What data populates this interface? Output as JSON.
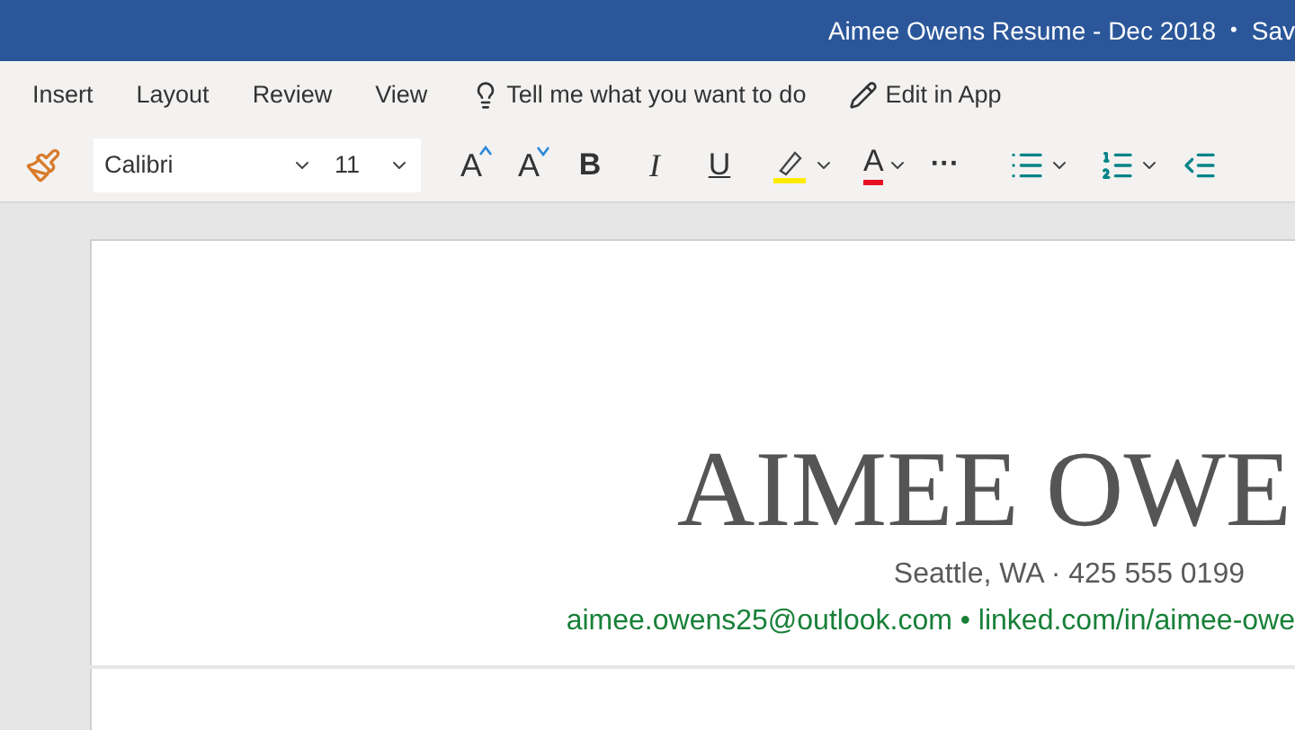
{
  "window": {
    "title": "Aimee Owens Resume - Dec 2018",
    "separator": "•",
    "status": "Sav"
  },
  "menu": [
    {
      "label": "Insert",
      "kind": "tab"
    },
    {
      "label": "Layout",
      "kind": "tab"
    },
    {
      "label": "Review",
      "kind": "tab"
    },
    {
      "label": "View",
      "kind": "tab"
    },
    {
      "label": "Tell me what you want to do",
      "kind": "search"
    },
    {
      "label": "Edit in App",
      "kind": "edit"
    }
  ],
  "toolbar": {
    "font": "Calibri",
    "size": "11",
    "buttons": [
      {
        "kind": "grow",
        "label": "A"
      },
      {
        "kind": "shrink",
        "label": "A"
      },
      {
        "kind": "bold",
        "label": "B"
      },
      {
        "kind": "italic",
        "label": "I"
      },
      {
        "kind": "underline",
        "label": "U"
      },
      {
        "kind": "highlight"
      },
      {
        "kind": "fontcolor",
        "label": "A"
      },
      {
        "kind": "more",
        "label": "···"
      },
      {
        "kind": "bullets"
      },
      {
        "kind": "numbering"
      },
      {
        "kind": "outdent"
      }
    ]
  },
  "document": {
    "name": "AIMEE OWE",
    "address": "Seattle, WA · 425 555 0199",
    "contact": "aimee.owens25@outlook.com • linked.com/in/aimee-owe"
  }
}
